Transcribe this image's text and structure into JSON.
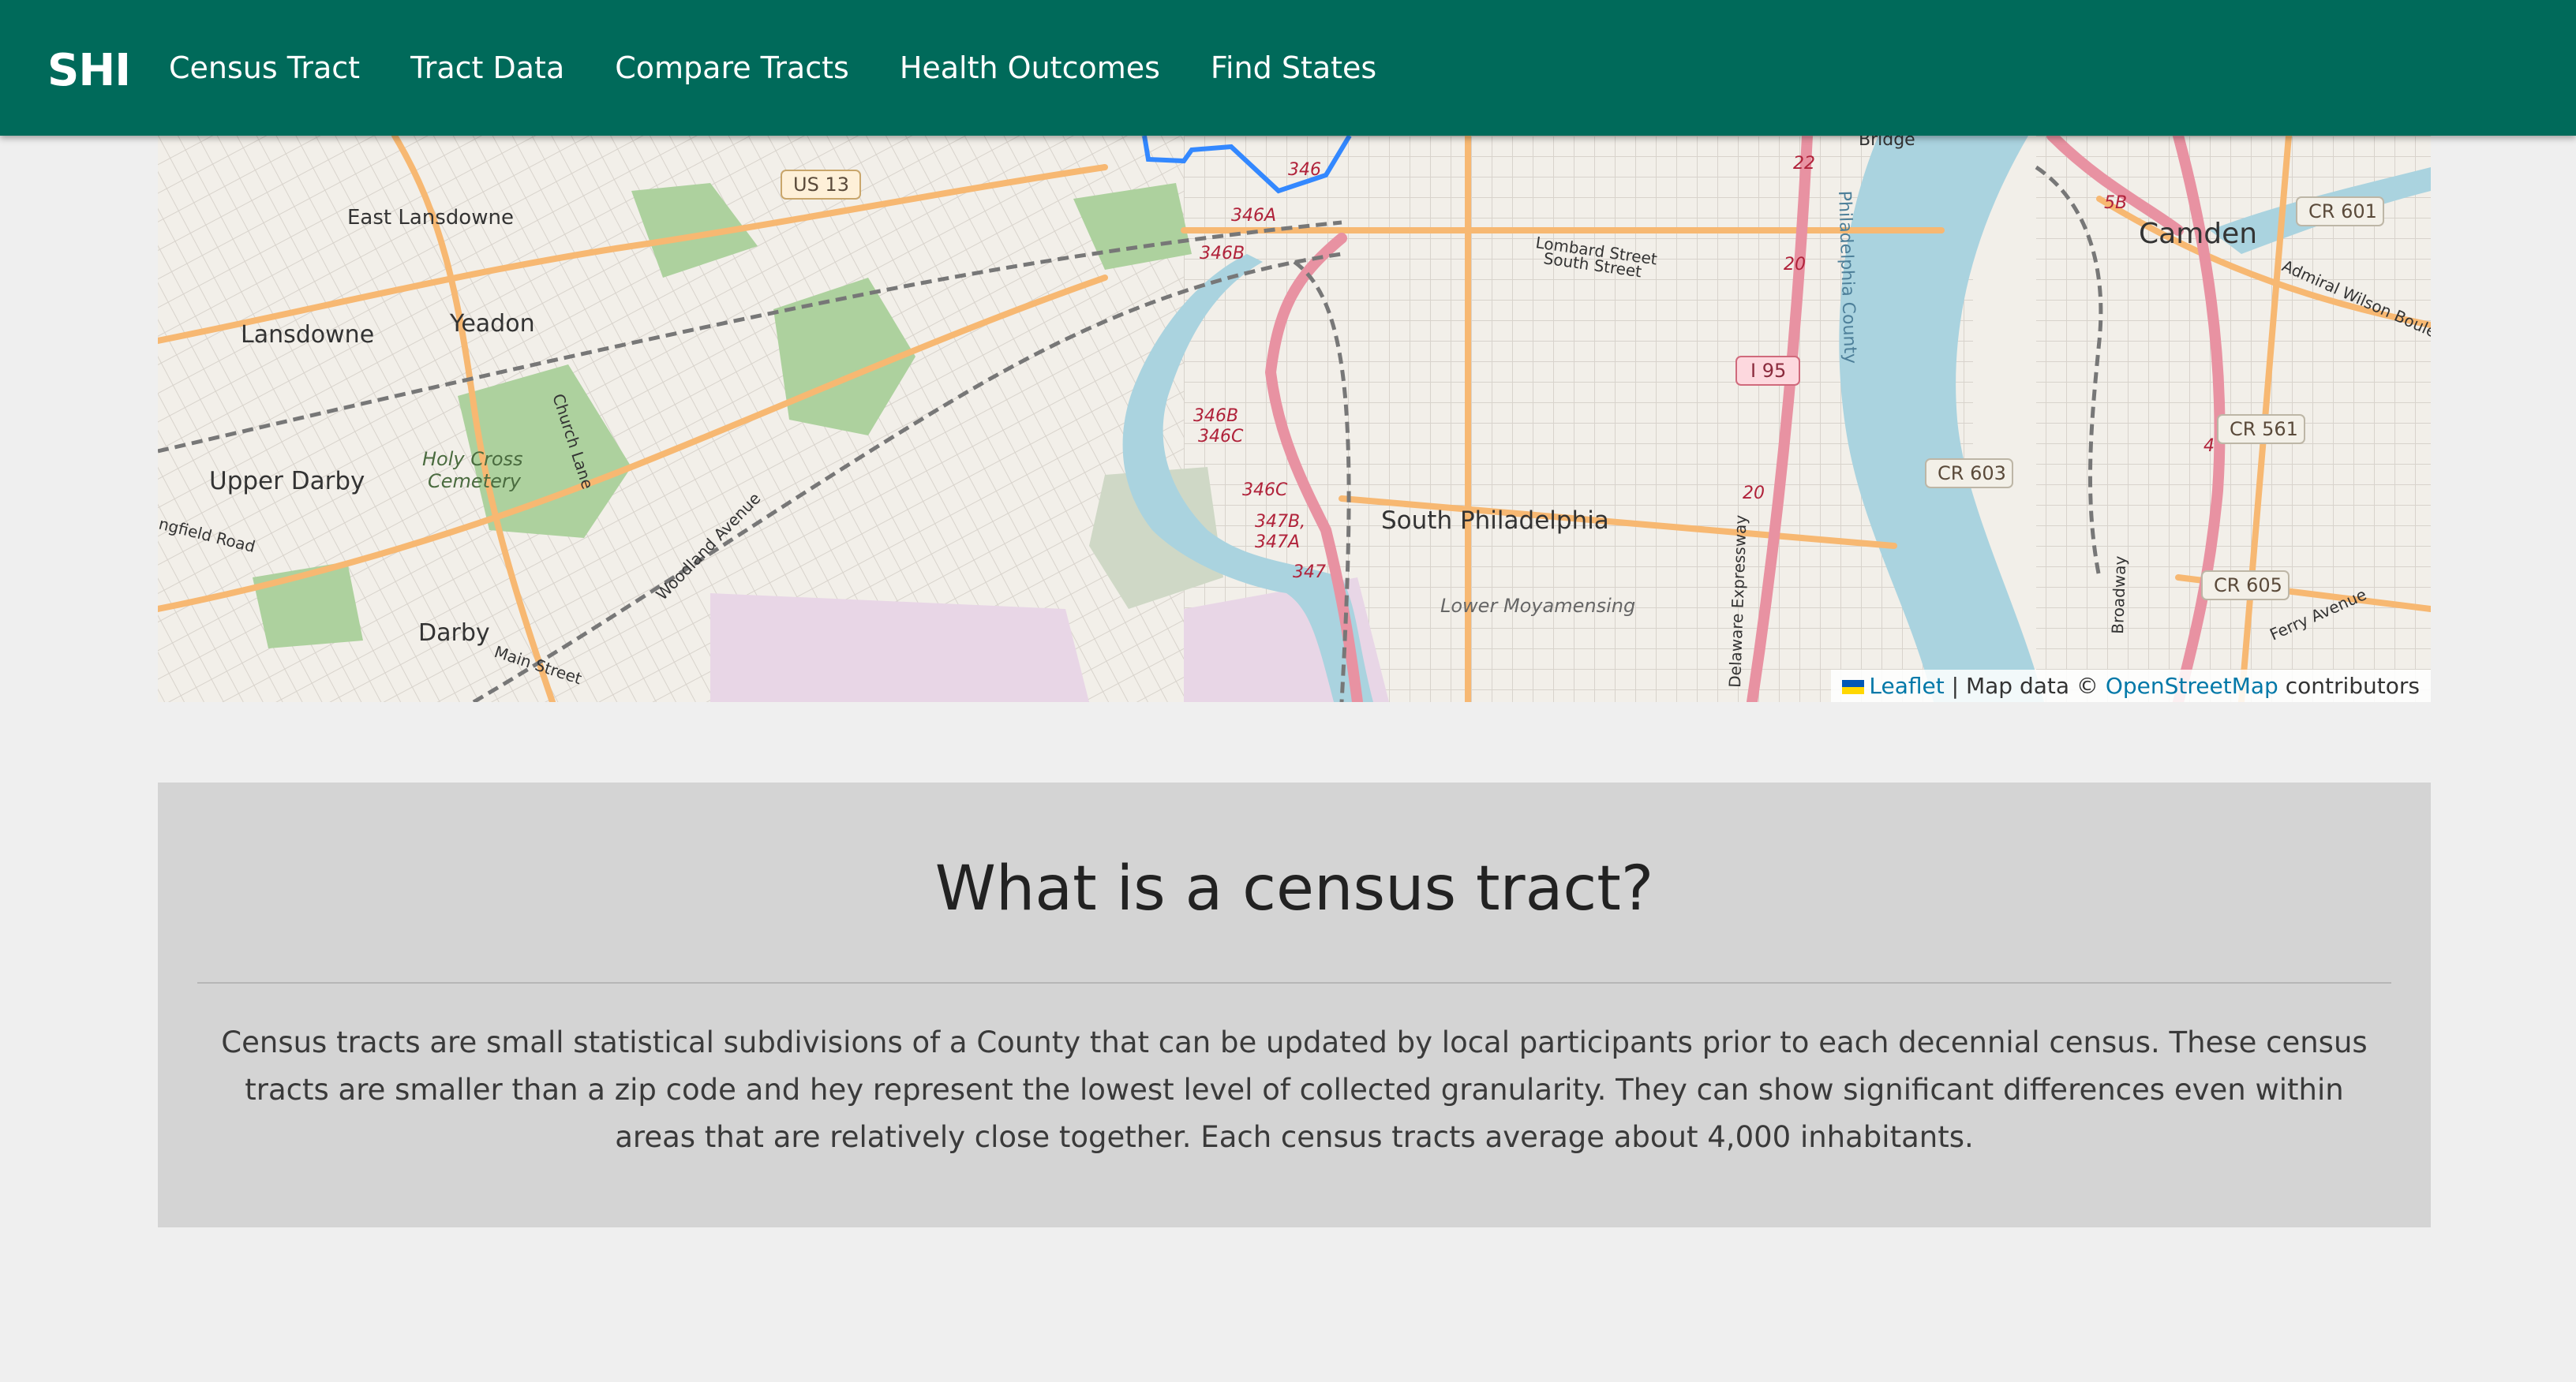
{
  "brand": "SHI",
  "nav": {
    "items": [
      "Census Tract",
      "Tract Data",
      "Compare Tracts",
      "Health Outcomes",
      "Find States"
    ]
  },
  "map": {
    "labels": {
      "east_lansdowne": "East Lansdowne",
      "lansdowne": "Lansdowne",
      "yeadon": "Yeadon",
      "upper_darby": "Upper Darby",
      "holy_cross_1": "Holy Cross",
      "holy_cross_2": "Cemetery",
      "darby": "Darby",
      "main_street": "Main Street",
      "springfield_road": "ngfield Road",
      "church_lane": "Church Lane",
      "woodland_avenue": "Woodland Avenue",
      "us13": "US 13",
      "south_philadelphia": "South Philadelphia",
      "lower_moyamensing": "Lower Moyamensing",
      "lombard_street": "Lombard Street",
      "south_street": "South Street",
      "philadelphia_county": "Philadelphia County",
      "delaware_expressway": "Delaware Expressway",
      "i95": "I 95",
      "camden": "Camden",
      "bridge": "Bridge",
      "cr601": "CR 601",
      "cr561": "CR 561",
      "cr603": "CR 603",
      "cr605": "CR 605",
      "admiral": "Admiral Wilson Bouleva",
      "ferry_avenue": "Ferry Avenue",
      "broadway": "Broadway",
      "exit_346a": "346A",
      "exit_346b_top": "346B",
      "exit_346b": "346B",
      "exit_346c_a": "346C",
      "exit_346c_b": "346C",
      "exit_347b": "347B,",
      "exit_347a": "347A",
      "exit_347": "347",
      "exit_346": "346",
      "exit_5b": "5B",
      "exit_22": "22",
      "exit_20a": "20",
      "exit_20b": "20",
      "exit_4": "4"
    },
    "attribution": {
      "leaflet": "Leaflet",
      "separator": "| Map data ©",
      "osm": "OpenStreetMap",
      "contributors": "contributors"
    },
    "colors": {
      "land": "#f2efe9",
      "water": "#aad3df",
      "park": "#add19e",
      "motorway": "#e892a2",
      "primary": "#fcd6a4",
      "railway": "#777777",
      "tract_outline": "#3388ff"
    }
  },
  "info": {
    "title": "What is a census tract?",
    "body": "Census tracts are small statistical subdivisions of a County that can be updated by local participants prior to each decennial census. These census tracts are smaller than a zip code and hey represent the lowest level of collected granularity. They can show significant differences even within areas that are relatively close together. Each census tracts average about 4,000 inhabitants."
  }
}
